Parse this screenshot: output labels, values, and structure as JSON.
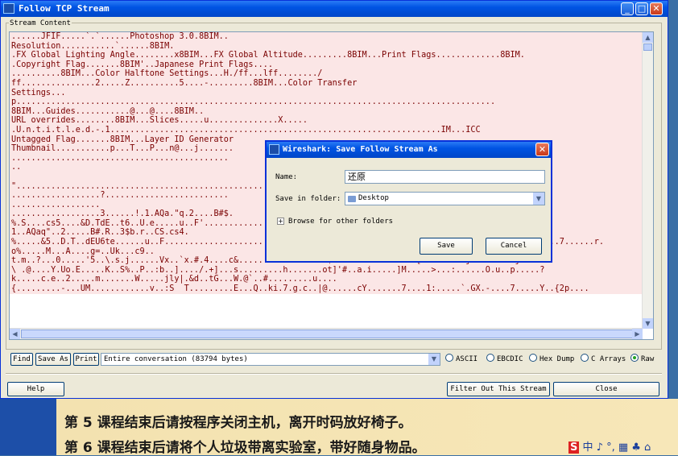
{
  "window": {
    "title": "Follow TCP Stream",
    "buttons": {
      "minimize": "_",
      "maximize": "□",
      "close": "✕"
    }
  },
  "group_label": "Stream Content",
  "stream_lines": [
    {
      "text": "......JFIF.....`.`......Photoshop 3.0.8BIM..",
      "side": "client"
    },
    {
      "text": "Resolution...........`......8BIM.",
      "side": "client"
    },
    {
      "text": ".FX Global Lighting Angle........x8BIM...FX Global Altitude.........8BIM...Print Flags.............8BIM.",
      "side": "client"
    },
    {
      "text": ".Copyright Flag.......8BIM'..Japanese Print Flags....",
      "side": "client"
    },
    {
      "text": "..........8BIM...Color Halftone Settings...H./ff...lff......../",
      "side": "client"
    },
    {
      "text": "ff...............2.....Z..........5....-.........8BIM...Color Transfer",
      "side": "client"
    },
    {
      "text": "Settings...",
      "side": "client"
    },
    {
      "text": "p.................................................................................................",
      "side": "client"
    },
    {
      "text": "8BIM...Guides...........@...@....8BIM..",
      "side": "client"
    },
    {
      "text": "URL overrides........8BIM...Slices.....u..............X.....",
      "side": "client"
    },
    {
      "text": ".U.n.t.i.t.l.e.d.-.1...................................................................IM...ICC",
      "side": "client"
    },
    {
      "text": "Untagged Flag.......8BIM...Layer ID Generator",
      "side": "client"
    },
    {
      "text": "Thumbnail...........p...T...P...n@...j.......",
      "side": "client"
    },
    {
      "text": "............................................",
      "side": "client"
    },
    {
      "text": "..",
      "side": "client"
    },
    {
      "text": "",
      "side": "client"
    },
    {
      "text": "\"....................................................................",
      "side": "client"
    },
    {
      "text": "..................?.........................",
      "side": "client"
    },
    {
      "text": "..................",
      "side": "client"
    },
    {
      "text": "..................3......!.1.AQa.\"q.2....B#$.",
      "side": "client"
    },
    {
      "text": "%.S....cs5....&D.TdE..t6..U.e.....u..F'..........................................................!",
      "side": "client"
    },
    {
      "text": "1..AQaq\"..2.....B#.R..3$b.r..CS.cs4.",
      "side": "client"
    },
    {
      "text": "%.....&5..D.T..dEU6te......u..F......................Vfv.......'7GWgw...................?....t.....e..\"..}.m<..7......r.",
      "side": "client"
    },
    {
      "text": "o%.....M...A....g=..Uk...c9..",
      "side": "client"
    },
    {
      "text": "t.m..?...0.....'5..\\.s.j......Vx..`x.#.4....c&.......z....R...K.$z..\"~..R.5..sz.P.[m....Z.k.j?.6=..Mw.j..",
      "side": "client"
    },
    {
      "text": "\\ .@....Y.Uo.E.....K..S%..P..:b..]..../.+]...s.........h.......ot]'#..a.i.....]M.....>...:......O.u..p.....?",
      "side": "client"
    },
    {
      "text": "k.....c.e..2.....m.......W.....jly|.&d..tG...W.@`..#.........u....",
      "side": "client"
    },
    {
      "text": "{.........-...UM............v..:S  T.........E...Q..ki.7.g.c..|@......cY.......7....1:.....`.GX.-....7.....Y..{2p....",
      "side": "client"
    }
  ],
  "toolbar": {
    "find": "Find",
    "save_as": "Save As",
    "print": "Print",
    "conversation": "Entire conversation (83794 bytes)",
    "formats": [
      {
        "label": "ASCII",
        "selected": false
      },
      {
        "label": "EBCDIC",
        "selected": false
      },
      {
        "label": "Hex Dump",
        "selected": false
      },
      {
        "label": "C Arrays",
        "selected": false
      },
      {
        "label": "Raw",
        "selected": true
      }
    ],
    "help": "Help",
    "filter_out": "Filter Out This Stream",
    "close": "Close"
  },
  "dialog": {
    "title": "Wireshark: Save Follow Stream As",
    "close_glyph": "✕",
    "name_label": "Name:",
    "name_value": "还原",
    "folder_label": "Save in folder:",
    "folder_value": "Desktop",
    "browse_label": "Browse for other folders",
    "expander": "+",
    "save": "Save",
    "cancel": "Cancel"
  },
  "desktop": {
    "notice_1": "第 5 课程结束后请按程序关闭主机，离开时码放好椅子。",
    "notice_2": "第 6 课程结束后请将个人垃圾带离实验室，带好随身物品。",
    "tray_s": "S",
    "tray_rest": "中 ♪ °, ▦ ♣ ⌂"
  },
  "colors": {
    "titlebar": "#0054e3",
    "client_bg": "#fbe6e6",
    "client_text": "#7a0000",
    "window_bg": "#ece9d8"
  }
}
